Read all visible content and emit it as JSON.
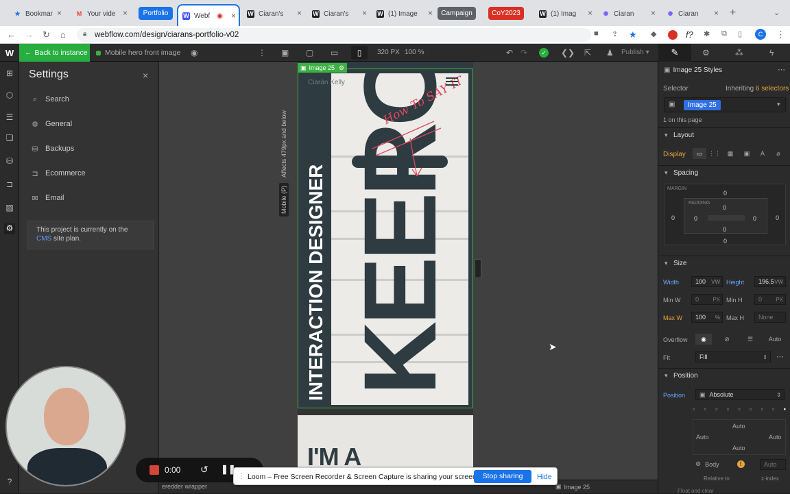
{
  "browser": {
    "tabs": [
      {
        "title": "Bookmar",
        "icon": "star-icon",
        "color": "#1a73e8"
      },
      {
        "title": "Your vide",
        "icon": "gmail-icon",
        "color": "#ea4335"
      },
      {
        "title": "Webf",
        "icon": "webflow-icon",
        "color": "#4353ff"
      },
      {
        "title": "Ciaran's",
        "icon": "webflow-icon",
        "color": "#222222"
      },
      {
        "title": "Ciaran's",
        "icon": "webflow-icon",
        "color": "#222222"
      },
      {
        "title": "(1) Image",
        "icon": "webflow-icon",
        "color": "#222222"
      },
      {
        "title": "(1) Imag",
        "icon": "webflow-icon",
        "color": "#222222"
      },
      {
        "title": "Ciaran",
        "icon": "atom-icon",
        "color": "#7b61ff"
      },
      {
        "title": "Ciaran",
        "icon": "atom-icon",
        "color": "#7b61ff"
      }
    ],
    "groups": [
      {
        "label": "Portfolio",
        "color": "#1a73e8"
      },
      {
        "label": "Campaign",
        "color": "#5f6368"
      },
      {
        "label": "CoY2023",
        "color": "#d93025"
      }
    ],
    "url": "webflow.com/design/ciarans-portfolio-v02"
  },
  "topbar": {
    "back": "Back to instance",
    "page": "Mobile hero front image",
    "viewport": "320 PX",
    "zoom": "100 %",
    "publish": "Publish"
  },
  "settings": {
    "title": "Settings",
    "items": [
      {
        "label": "Search",
        "icon": "search-icon"
      },
      {
        "label": "General",
        "icon": "gear-icon"
      },
      {
        "label": "Backups",
        "icon": "backups-icon"
      },
      {
        "label": "Ecommerce",
        "icon": "cart-icon"
      },
      {
        "label": "Email",
        "icon": "mail-icon"
      }
    ],
    "notice_pre": "This project is currently on the",
    "notice_link": "CMS",
    "notice_post": "site plan."
  },
  "canvas": {
    "breakpoint_label": "Mobile (P)",
    "breakpoint_note": "Affects 479px and below",
    "element_badge": "Image 25",
    "site_brand": "Ciarán Kelly",
    "hero_big": "KEERON",
    "hero_sub": "INTERACTION DESIGNER",
    "scribble": "How To SAY IT",
    "below_text": "I'M A"
  },
  "panel": {
    "styles_title": "Image 25 Styles",
    "selector_label": "Selector",
    "inheriting": "Inheriting",
    "selectors_count": "6 selectors",
    "selector_chip": "Image 25",
    "on_page": "1 on this page",
    "layout": "Layout",
    "display": "Display",
    "spacing": "Spacing",
    "margin": "MARGIN",
    "padding": "PADDING",
    "zero": "0",
    "size": "Size",
    "width": "Width",
    "width_val": "100",
    "width_unit": "VW",
    "height": "Height",
    "height_val": "196.5",
    "height_unit": "VW",
    "minw": "Min W",
    "minw_val": "0",
    "px": "PX",
    "minh": "Min H",
    "minh_val": "0",
    "maxw": "Max W",
    "maxw_val": "100",
    "pct": "%",
    "maxh": "Max H",
    "maxh_val": "None",
    "overflow": "Overflow",
    "auto": "Auto",
    "fit": "Fit",
    "fit_val": "Fill",
    "position": "Position",
    "position_val": "Absolute",
    "body": "Body",
    "relative_to": "Relative to",
    "z_index": "z-index",
    "float_clear": "Float and clear"
  },
  "recorder": {
    "time": "0:00",
    "share_msg": "Loom – Free Screen Recorder & Screen Capture is sharing your screen.",
    "stop": "Stop sharing",
    "hide": "Hide"
  },
  "bottom": {
    "crumb1": "eredder wrapper",
    "crumb2": "Image 25"
  }
}
